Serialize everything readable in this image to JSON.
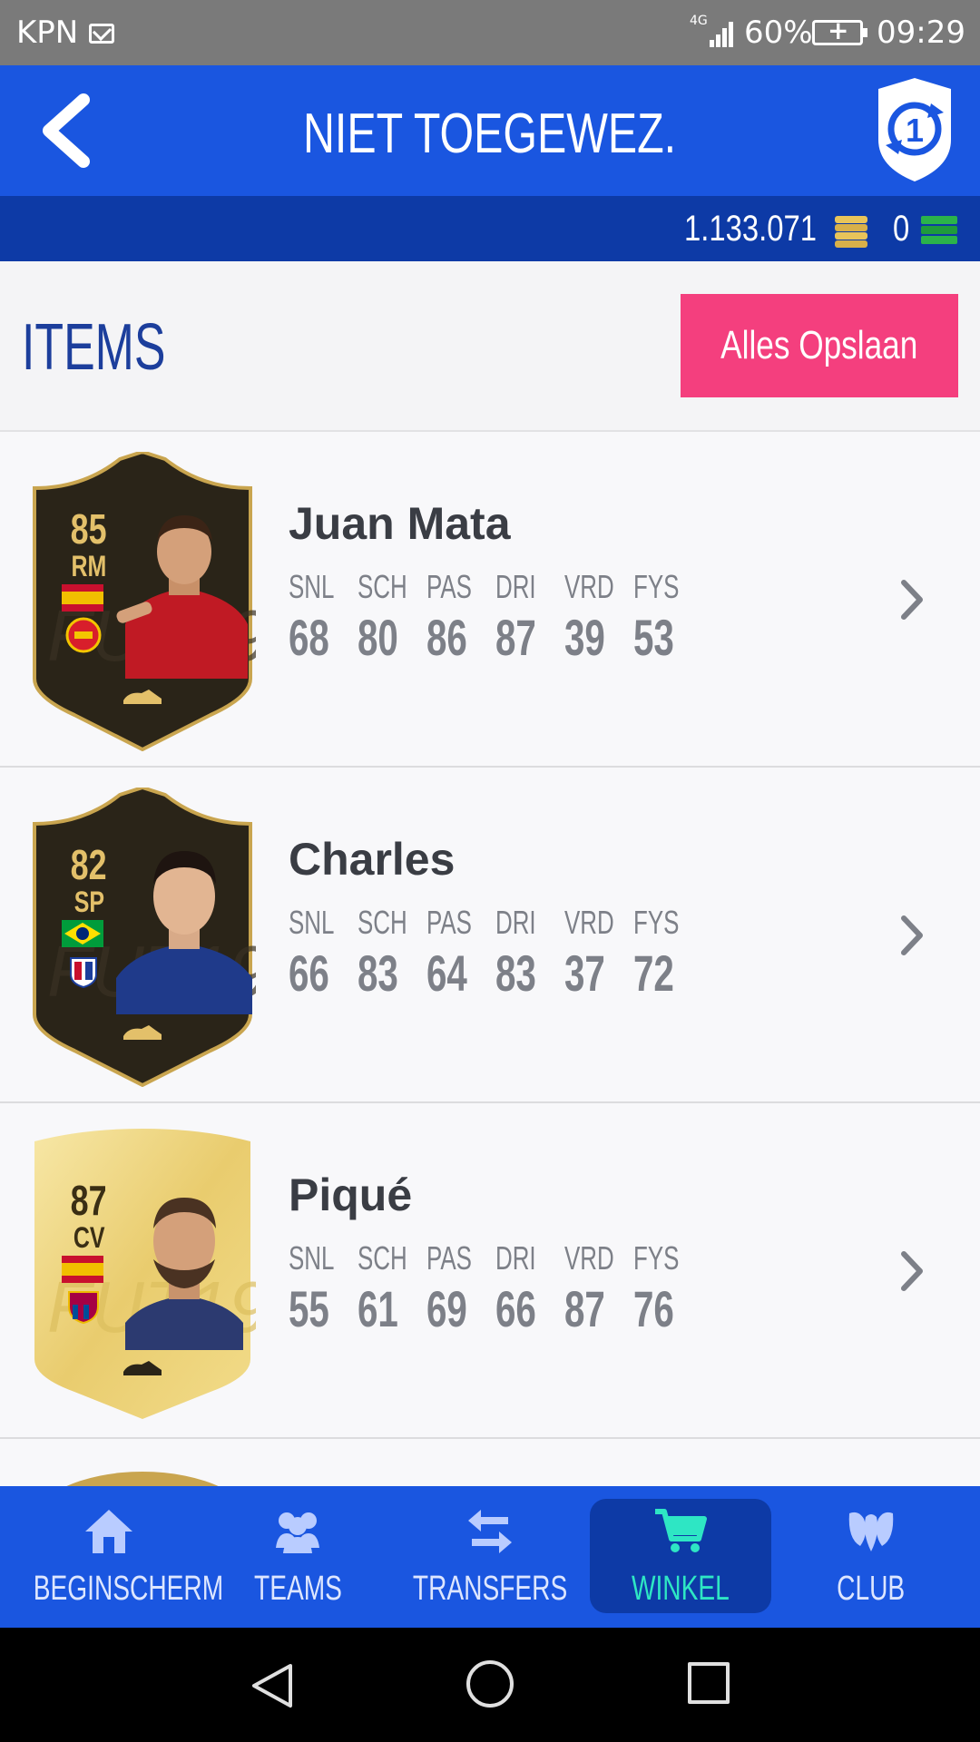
{
  "status_bar": {
    "carrier": "KPN",
    "network": "4G",
    "battery": "60%",
    "time": "09:29"
  },
  "header": {
    "title": "NIET TOEGEWEZ.",
    "coins": "1.133.071",
    "points": "0"
  },
  "section": {
    "title": "ITEMS",
    "save_all_label": "Alles Opslaan"
  },
  "stat_labels": [
    "SNL",
    "SCH",
    "PAS",
    "DRI",
    "VRD",
    "FYS"
  ],
  "players": [
    {
      "name": "Juan Mata",
      "rating": "85",
      "position": "RM",
      "card_style": "black",
      "stats": [
        "68",
        "80",
        "86",
        "87",
        "39",
        "53"
      ]
    },
    {
      "name": "Charles",
      "rating": "82",
      "position": "SP",
      "card_style": "black",
      "stats": [
        "66",
        "83",
        "64",
        "83",
        "37",
        "72"
      ]
    },
    {
      "name": "Piqué",
      "rating": "87",
      "position": "CV",
      "card_style": "gold",
      "stats": [
        "55",
        "61",
        "69",
        "66",
        "87",
        "76"
      ]
    }
  ],
  "bottom_nav": [
    {
      "label": "BEGINSCHERM",
      "icon": "home-icon",
      "active": false
    },
    {
      "label": "TEAMS",
      "icon": "teams-icon",
      "active": false
    },
    {
      "label": "TRANSFERS",
      "icon": "transfers-icon",
      "active": false
    },
    {
      "label": "WINKEL",
      "icon": "cart-icon",
      "active": true
    },
    {
      "label": "CLUB",
      "icon": "club-icon",
      "active": false
    }
  ],
  "colors": {
    "header_blue": "#1a56e0",
    "currency_bar": "#0d3aa6",
    "save_button": "#f43f7e",
    "active_nav_label": "#2ee6c4"
  }
}
